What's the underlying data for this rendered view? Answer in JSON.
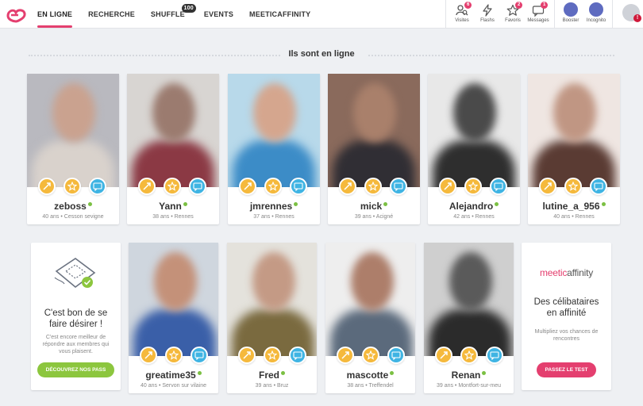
{
  "nav": {
    "items": [
      {
        "label": "EN LIGNE",
        "active": true
      },
      {
        "label": "RECHERCHE",
        "active": false
      },
      {
        "label": "SHUFFLE",
        "active": false,
        "badge": "100"
      },
      {
        "label": "EVENTS",
        "active": false
      },
      {
        "label": "MEETICAFFINITY",
        "active": false
      }
    ]
  },
  "tools": [
    {
      "label": "Visites",
      "icon": "visits-icon",
      "count": "6"
    },
    {
      "label": "Flashs",
      "icon": "flash-icon",
      "count": ""
    },
    {
      "label": "Favoris",
      "icon": "star-icon",
      "count": "2"
    },
    {
      "label": "Messages",
      "icon": "message-icon",
      "count": "1"
    }
  ],
  "extras": [
    {
      "label": "Booster",
      "icon": "booster-icon"
    },
    {
      "label": "Incognito",
      "icon": "incognito-icon"
    }
  ],
  "user_alert": "!",
  "section_title": "Ils sont en ligne",
  "profiles": [
    {
      "name": "zeboss",
      "info": "40 ans • Cesson sevigne"
    },
    {
      "name": "Yann",
      "info": "38 ans • Rennes"
    },
    {
      "name": "jmrennes",
      "info": "37 ans • Rennes"
    },
    {
      "name": "mick",
      "info": "39 ans • Acigné"
    },
    {
      "name": "Alejandro",
      "info": "42 ans • Rennes"
    },
    {
      "name": "lutine_a_956",
      "info": "40 ans • Rennes"
    },
    {
      "name": "greatime35",
      "info": "40 ans • Servon sur vilaine"
    },
    {
      "name": "Fred",
      "info": "39 ans • Bruz"
    },
    {
      "name": "mascotte",
      "info": "38 ans • Treffendel"
    },
    {
      "name": "Renan",
      "info": "39 ans • Montfort-sur-meu"
    }
  ],
  "promo_pass": {
    "title": "C'est bon de se faire désirer !",
    "text": "C'est encore meilleur de répondre aux membres qui vous plaisent.",
    "button": "DÉCOUVREZ NOS PASS"
  },
  "promo_affinity": {
    "logo_a": "meetic",
    "logo_b": "affinity",
    "title": "Des célibataires en affinité",
    "text": "Multipliez vos chances de rencontres",
    "button": "PASSEZ LE TEST"
  },
  "colors": {
    "accent": "#e43f6f",
    "online": "#7bc043",
    "flash": "#f5b93c",
    "message": "#3fb4e3",
    "pass_button": "#8cc63e"
  }
}
